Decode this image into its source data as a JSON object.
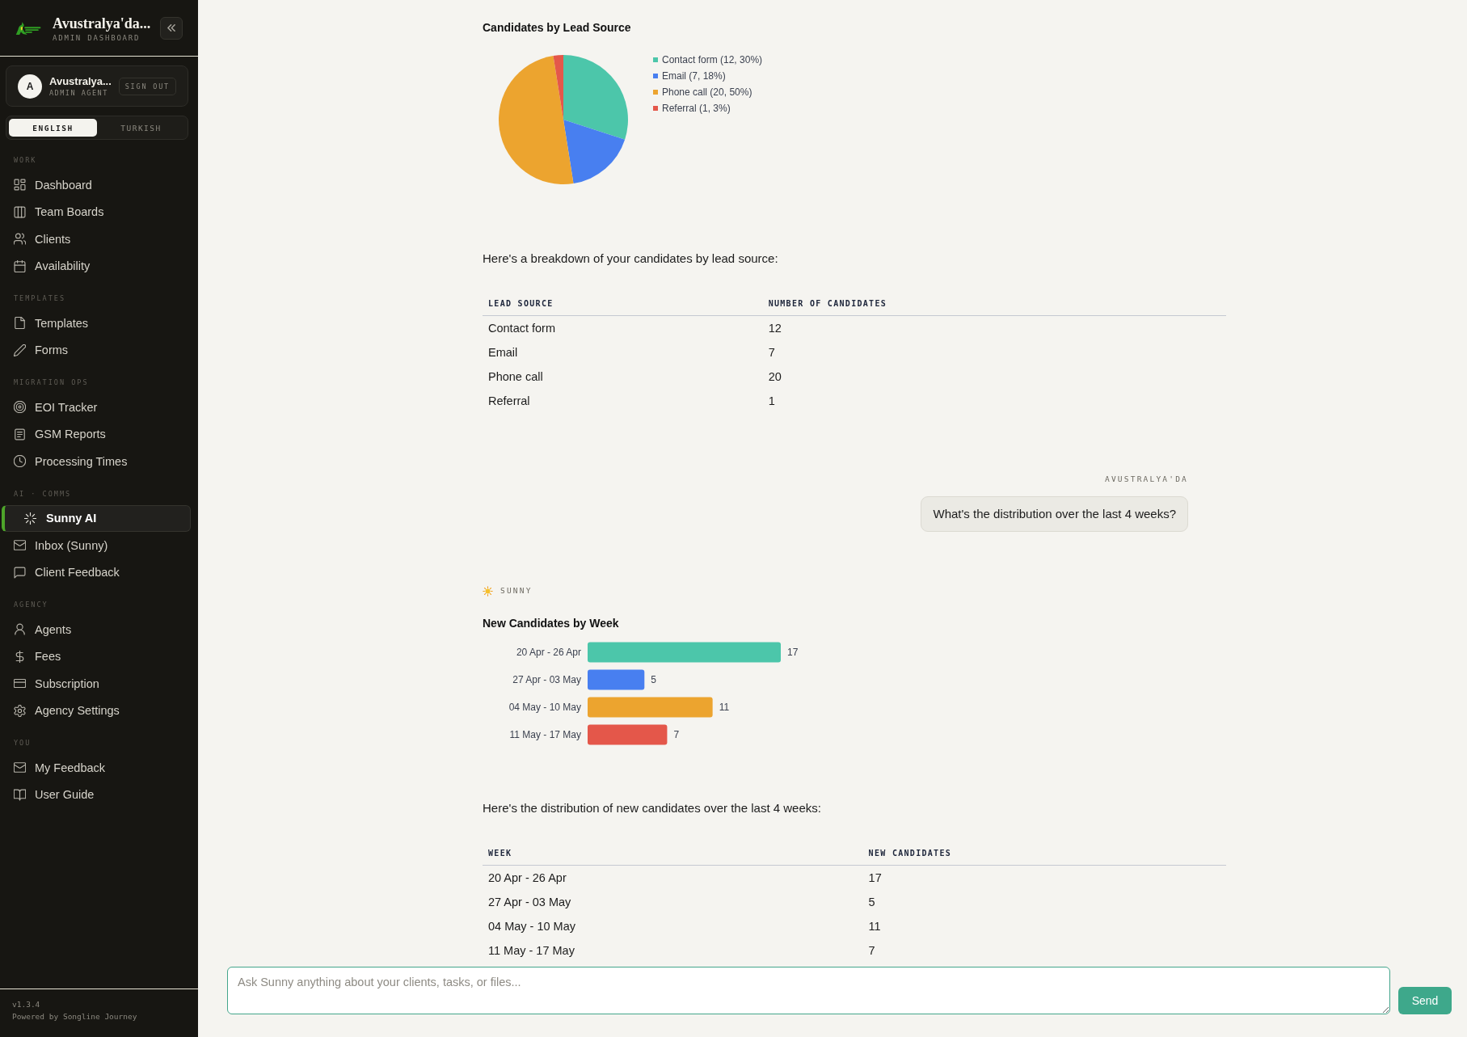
{
  "sidebar": {
    "brand": {
      "title": "Avustralya'da...",
      "subtitle": "ADMIN DASHBOARD"
    },
    "user": {
      "initial": "A",
      "name": "Avustralya...",
      "role": "ADMIN AGENT",
      "sign_out": "SIGN OUT"
    },
    "language": [
      {
        "label": "ENGLISH",
        "selected": true
      },
      {
        "label": "TURKISH",
        "selected": false
      }
    ],
    "sections": [
      {
        "heading": "WORK",
        "items": [
          {
            "label": "Dashboard",
            "selected": false
          },
          {
            "label": "Team Boards",
            "selected": false
          },
          {
            "label": "Clients",
            "selected": false
          },
          {
            "label": "Availability",
            "selected": false
          }
        ]
      },
      {
        "heading": "TEMPLATES",
        "items": [
          {
            "label": "Templates",
            "selected": false
          },
          {
            "label": "Forms",
            "selected": false
          }
        ]
      },
      {
        "heading": "MIGRATION OPS",
        "items": [
          {
            "label": "EOI Tracker",
            "selected": false
          },
          {
            "label": "GSM Reports",
            "selected": false
          },
          {
            "label": "Processing Times",
            "selected": false
          }
        ]
      },
      {
        "heading": "AI · COMMS",
        "items": [
          {
            "label": "Sunny AI",
            "selected": true
          },
          {
            "label": "Inbox (Sunny)",
            "selected": false
          },
          {
            "label": "Client Feedback",
            "selected": false
          }
        ]
      },
      {
        "heading": "AGENCY",
        "items": [
          {
            "label": "Agents",
            "selected": false
          },
          {
            "label": "Fees",
            "selected": false
          },
          {
            "label": "Subscription",
            "selected": false
          },
          {
            "label": "Agency Settings",
            "selected": false
          }
        ]
      },
      {
        "heading": "YOU",
        "items": [
          {
            "label": "My Feedback",
            "selected": false
          },
          {
            "label": "User Guide",
            "selected": false
          }
        ]
      }
    ],
    "footer": {
      "version": "v1.3.4",
      "credit": "Powered by Songline Journey"
    }
  },
  "messages": [
    {
      "kind": "assistant",
      "blocks": [
        {
          "kind": "pie_chart",
          "title": "Candidates by Lead Source",
          "chart_data": {
            "type": "pie",
            "categories": [
              "Contact form (12, 30%)",
              "Email (7, 18%)",
              "Phone call (20, 50%)",
              "Referral (1, 3%)"
            ],
            "values": [
              12,
              7,
              20,
              1
            ],
            "colors": [
              "#4cc6aa",
              "#487ff0",
              "#eca42f",
              "#e4574a"
            ],
            "legend": "right"
          }
        },
        {
          "kind": "text",
          "text": "Here's a breakdown of your candidates by lead source:"
        },
        {
          "kind": "table",
          "columns": [
            "LEAD SOURCE",
            "NUMBER OF CANDIDATES"
          ],
          "rows": [
            [
              "Contact form",
              "12"
            ],
            [
              "Email",
              "7"
            ],
            [
              "Phone call",
              "20"
            ],
            [
              "Referral",
              "1"
            ]
          ]
        }
      ]
    },
    {
      "kind": "user",
      "sender": "AVUSTRALYA'DA",
      "text": "What's the distribution over the last 4 weeks?"
    },
    {
      "kind": "assistant",
      "sender": "SUNNY",
      "blocks": [
        {
          "kind": "bar_chart",
          "title": "New Candidates by Week",
          "chart_data": {
            "type": "bar",
            "orientation": "horizontal",
            "categories": [
              "20 Apr - 26 Apr",
              "27 Apr - 03 May",
              "04 May - 10 May",
              "11 May - 17 May"
            ],
            "values": [
              17,
              5,
              11,
              7
            ],
            "value_labels": [
              "17",
              "5",
              "11",
              "7"
            ],
            "colors": [
              "#4cc6aa",
              "#487ff0",
              "#eca42f",
              "#e4574a"
            ]
          }
        },
        {
          "kind": "text",
          "text": "Here's the distribution of new candidates over the last 4 weeks:"
        },
        {
          "kind": "table",
          "columns": [
            "WEEK",
            "NEW CANDIDATES"
          ],
          "rows": [
            [
              "20 Apr - 26 Apr",
              "17"
            ],
            [
              "27 Apr - 03 May",
              "5"
            ],
            [
              "04 May - 10 May",
              "11"
            ],
            [
              "11 May - 17 May",
              "7"
            ]
          ]
        }
      ]
    }
  ],
  "composer": {
    "placeholder": "Ask Sunny anything about your clients, tasks, or files...",
    "send_label": "Send"
  }
}
